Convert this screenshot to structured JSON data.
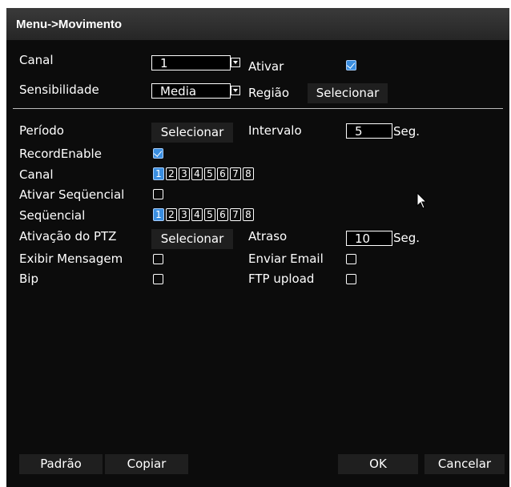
{
  "window": {
    "title": "Menu->Movimento"
  },
  "top": {
    "canal_label": "Canal",
    "canal_value": "1",
    "ativar_label": "Ativar",
    "ativar_checked": true,
    "sens_label": "Sensibilidade",
    "sens_value": "Media",
    "regiao_label": "Região",
    "regiao_button": "Selecionar"
  },
  "settings": {
    "periodo_label": "Período",
    "periodo_button": "Selecionar",
    "intervalo_label": "Intervalo",
    "intervalo_value": "5",
    "intervalo_unit": "Seg.",
    "record_label": "RecordEnable",
    "record_checked": true,
    "canal_label": "Canal",
    "channels": [
      "1",
      "2",
      "3",
      "4",
      "5",
      "6",
      "7",
      "8"
    ],
    "canal_selected": "1",
    "ativar_seq_label": "Ativar Seqüencial",
    "seq_label": "Seqüencial",
    "seq_selected": "1",
    "ptz_label": "Ativação do PTZ",
    "ptz_button": "Selecionar",
    "atraso_label": "Atraso",
    "atraso_value": "10",
    "atraso_unit": "Seg.",
    "exibir_label": "Exibir Mensagem",
    "email_label": "Enviar Email",
    "bip_label": "Bip",
    "ftp_label": "FTP upload"
  },
  "footer": {
    "padrao": "Padrão",
    "copiar": "Copiar",
    "ok": "OK",
    "cancelar": "Cancelar"
  },
  "colors": {
    "accent": "#3a8ee0",
    "background": "#0c0c0c",
    "button": "#1f1f1f"
  },
  "icons": {
    "cursor": "mouse-pointer-icon",
    "dropdown": "dropdown-arrow-icon",
    "checkbox": "checkbox-icon"
  }
}
